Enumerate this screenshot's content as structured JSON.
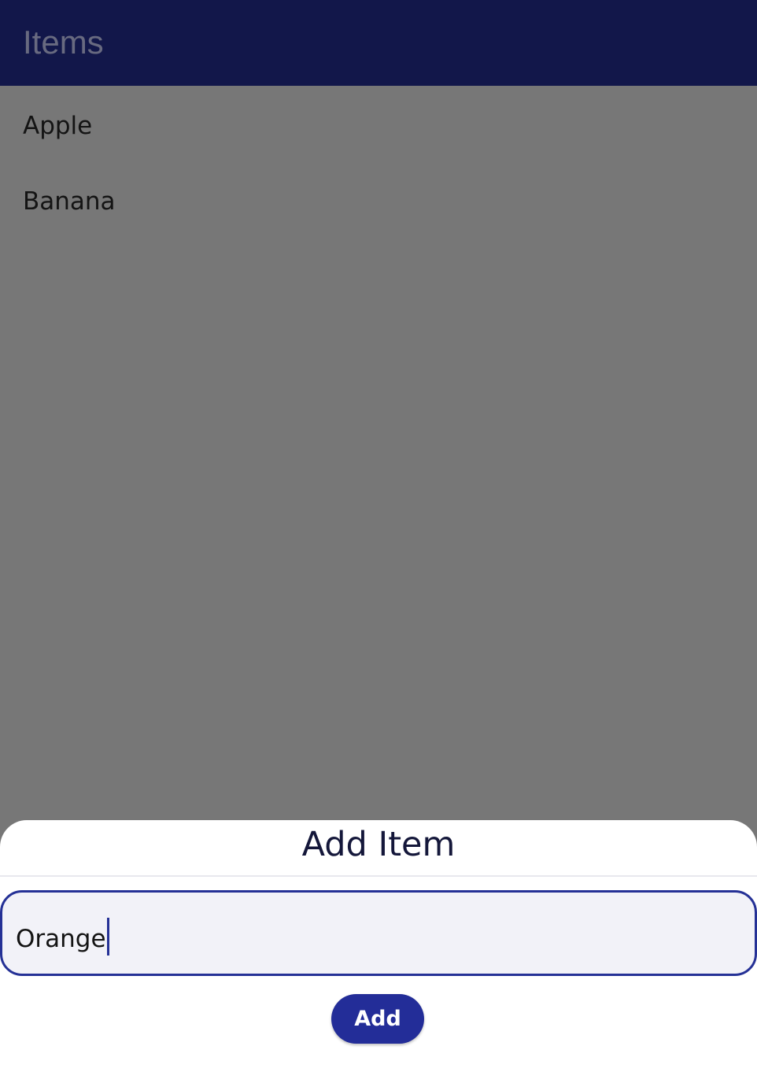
{
  "app_bar": {
    "title": "Items",
    "background_color": "#12174a"
  },
  "list": {
    "items": [
      {
        "label": "Apple"
      },
      {
        "label": "Banana"
      }
    ]
  },
  "sheet": {
    "title": "Add Item",
    "input": {
      "value": "Orange",
      "focused": true
    },
    "add_button_label": "Add",
    "accent_color": "#253196"
  },
  "overlay_color": "#777777"
}
